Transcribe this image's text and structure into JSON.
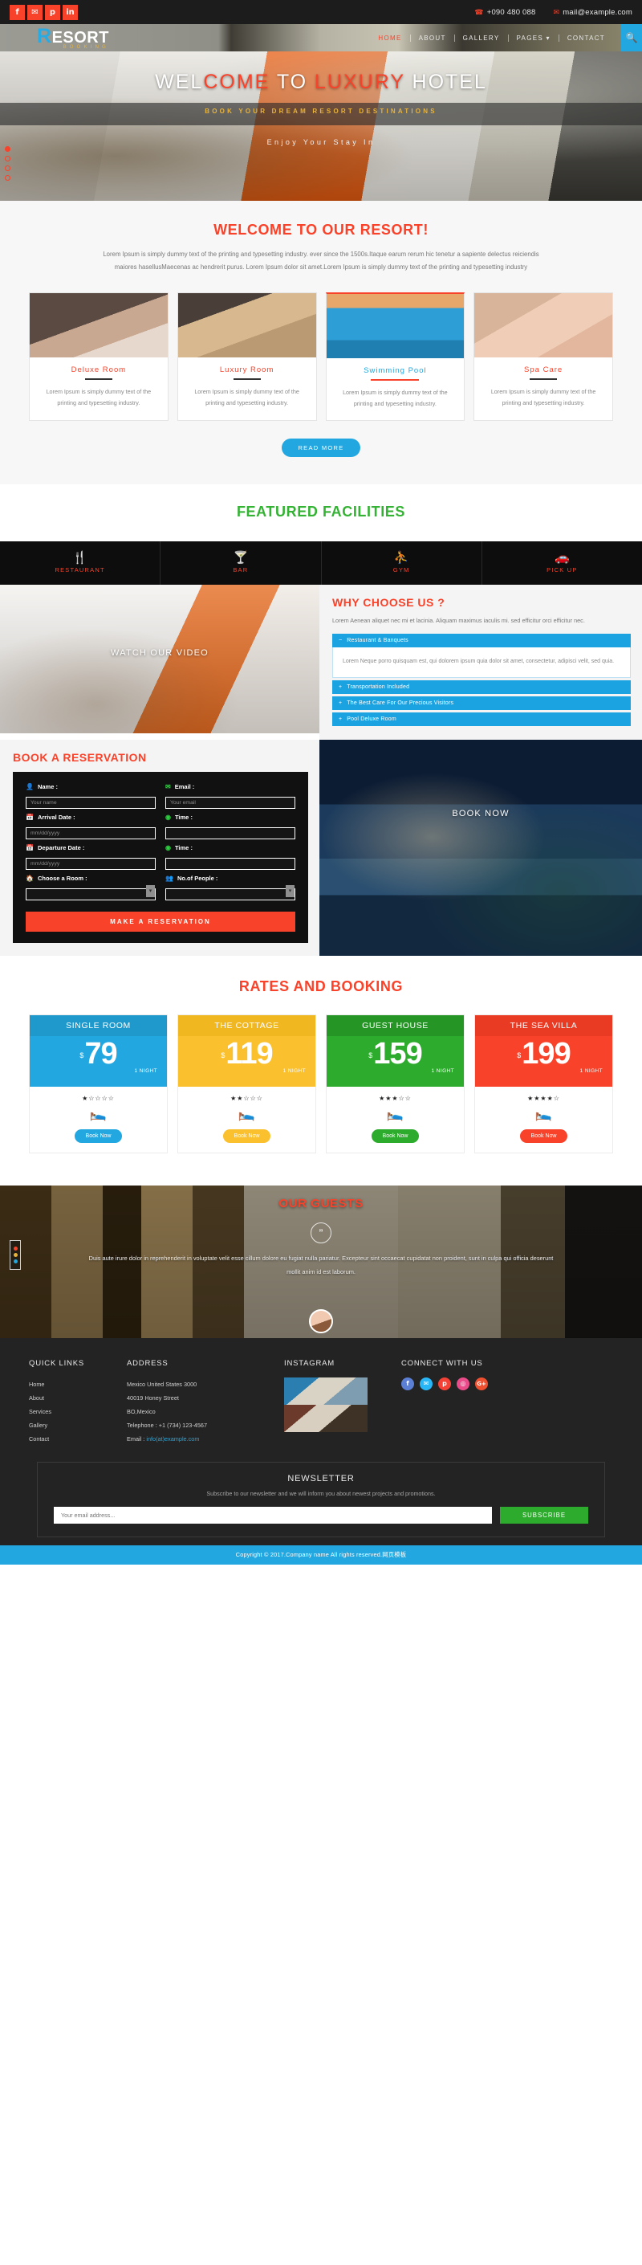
{
  "topbar": {
    "social": [
      {
        "name": "facebook-icon",
        "glyph": "f"
      },
      {
        "name": "twitter-icon",
        "glyph": "✉"
      },
      {
        "name": "pinterest-icon",
        "glyph": "p"
      },
      {
        "name": "linkedin-icon",
        "glyph": "in"
      }
    ],
    "phone": "+090 480 088",
    "email": "mail@example.com",
    "phone_icon": "phone-icon",
    "email_icon": "envelope-icon"
  },
  "header": {
    "logo_initial": "R",
    "logo_rest": "ESORT",
    "logo_sub": "BOOKING",
    "nav": [
      {
        "label": "HOME",
        "active": true
      },
      {
        "label": "ABOUT",
        "active": false
      },
      {
        "label": "GALLERY",
        "active": false
      },
      {
        "label": "PAGES ▾",
        "active": false
      },
      {
        "label": "CONTACT",
        "active": false
      }
    ],
    "search_icon": "search-icon"
  },
  "hero": {
    "title_pre": "WEL",
    "title_accent1": "COME",
    "title_mid": " TO ",
    "title_accent2": "LUXURY",
    "title_post": " HOTEL",
    "subtitle": "BOOK YOUR DREAM RESORT DESTINATIONS",
    "tagline": "Enjoy Your Stay In"
  },
  "welcome": {
    "title": "WELCOME TO OUR RESORT!",
    "lead": "Lorem Ipsum is simply dummy text of the printing and typesetting industry. ever since the 1500s.Itaque earum rerum hic tenetur a sapiente delectus reiciendis maiores hasellusMaecenas ac hendrerit purus. Lorem Ipsum dolor sit amet.Lorem Ipsum is simply dummy text of the printing and typesetting industry",
    "cards": [
      {
        "title": "Deluxe Room",
        "text": "Lorem Ipsum is simply dummy text of the printing and typesetting industry."
      },
      {
        "title": "Luxury Room",
        "text": "Lorem Ipsum is simply dummy text of the printing and typesetting industry."
      },
      {
        "title": "Swimming Pool",
        "text": "Lorem Ipsum is simply dummy text of the printing and typesetting industry."
      },
      {
        "title": "Spa Care",
        "text": "Lorem Ipsum is simply dummy text of the printing and typesetting industry."
      }
    ],
    "read_more": "READ MORE"
  },
  "facilities": {
    "title": "FEATURED FACILITIES",
    "items": [
      {
        "label": "RESTAURANT",
        "icon": "fork-knife-icon",
        "glyph": "🍴"
      },
      {
        "label": "BAR",
        "icon": "cocktail-glass-icon",
        "glyph": "ᵥ"
      },
      {
        "label": "GYM",
        "icon": "gym-person-icon",
        "glyph": "⛹"
      },
      {
        "label": "PICK UP",
        "icon": "car-icon",
        "glyph": "🚗"
      }
    ]
  },
  "video": {
    "label": "WATCH OUR VIDEO"
  },
  "why": {
    "title": "WHY CHOOSE US ?",
    "desc": "Lorem Aenean aliquet nec mi et lacinia. Aliquam maximus iaculis mi. sed efficitur orci efficitur nec.",
    "accordion": [
      {
        "label": "Restaurant & Banquets",
        "sign": "−",
        "open": true,
        "body": "Lorem Neque porro quisquam est, qui dolorem ipsum quia dolor sit amet, consectetur, adipisci velit, sed quia."
      },
      {
        "label": "Transportation Included",
        "sign": "+",
        "open": false,
        "body": ""
      },
      {
        "label": "The Best Care For Our Precious Visitors",
        "sign": "+",
        "open": false,
        "body": ""
      },
      {
        "label": "Pool Deluxe Room",
        "sign": "+",
        "open": false,
        "body": ""
      }
    ]
  },
  "booking": {
    "title": "BOOK A RESERVATION",
    "fields": {
      "name_label": "Name :",
      "name_placeholder": "Your name",
      "name_icon": "user-icon",
      "email_label": "Email :",
      "email_placeholder": "Your email",
      "email_icon": "envelope-icon",
      "arrival_label": "Arrival Date :",
      "arrival_placeholder": "mm/dd/yyyy",
      "arrival_icon": "calendar-icon",
      "arrival_time_label": "Time :",
      "arrival_time_value": "",
      "time_icon": "clock-icon",
      "departure_label": "Departure Date :",
      "departure_placeholder": "mm/dd/yyyy",
      "departure_icon": "calendar-icon",
      "departure_time_label": "Time :",
      "departure_time_value": "",
      "room_label": "Choose a Room :",
      "room_value": "",
      "room_icon": "home-icon",
      "people_label": "No.of People :",
      "people_value": "",
      "people_icon": "group-icon"
    },
    "submit": "MAKE A RESERVATION",
    "booknow_label": "BOOK NOW"
  },
  "rates": {
    "title": "RATES AND BOOKING",
    "plans": [
      {
        "name": "SINGLE ROOM",
        "currency": "$",
        "price": "79",
        "per": "1 NIGHT",
        "stars": 1,
        "color": "#22a7e0",
        "head": "#1f98cc",
        "cta": "Book Now"
      },
      {
        "name": "THE COTTAGE",
        "currency": "$",
        "price": "119",
        "per": "1 NIGHT",
        "stars": 2,
        "color": "#fbc02d",
        "head": "#f1b720",
        "cta": "Book Now"
      },
      {
        "name": "GUEST HOUSE",
        "currency": "$",
        "price": "159",
        "per": "1 NIGHT",
        "stars": 3,
        "color": "#2cab2c",
        "head": "#259625",
        "cta": "Book Now"
      },
      {
        "name": "THE SEA VILLA",
        "currency": "$",
        "price": "199",
        "per": "1 NIGHT",
        "stars": 4,
        "color": "#f9422a",
        "head": "#e93a24",
        "cta": "Book Now"
      }
    ],
    "bed_icon": "bed-icon",
    "star_filled": "★",
    "star_empty": "☆"
  },
  "guests": {
    "title": "OUR GUESTS",
    "quote_icon": "quote-icon",
    "quote": "Duis aute irure dolor in reprehenderit in voluptate velit esse cillum dolore eu fugiat nulla pariatur. Excepteur sint occaecat cupidatat non proident, sunt in culpa qui officia deserunt mollit anim id est laborum.",
    "avatar": "guest-avatar"
  },
  "footer": {
    "quick_links_title": "QUICK LINKS",
    "quick_links": [
      "Home",
      "About",
      "Services",
      "Gallery",
      "Contact"
    ],
    "address_title": "ADDRESS",
    "address_lines": [
      "Mexico United States 3000",
      "40019 Honey Street",
      "BO,Mexico"
    ],
    "telephone": "Telephone : +1 (734) 123-4567",
    "email_label": "Email : ",
    "email_value": "info(at)example.com",
    "instagram_title": "INSTAGRAM",
    "connect_title": "CONNECT WITH US",
    "socials": [
      {
        "name": "facebook-icon",
        "glyph": "f",
        "color": "#5b7fd4"
      },
      {
        "name": "twitter-icon",
        "glyph": "✉",
        "color": "#29b6f6"
      },
      {
        "name": "pinterest-icon",
        "glyph": "p",
        "color": "#f44336"
      },
      {
        "name": "dribbble-icon",
        "glyph": "◎",
        "color": "#ea4c89"
      },
      {
        "name": "google-plus-icon",
        "glyph": "G+",
        "color": "#ef5030"
      }
    ],
    "newsletter_title": "NEWSLETTER",
    "newsletter_sub": "Subscribe to our newsletter and we will inform you about newest projects and promotions.",
    "newsletter_placeholder": "Your email address...",
    "newsletter_btn": "SUBSCRIBE",
    "copyright": "Copyright © 2017.Company name All rights reserved.网页模板"
  }
}
